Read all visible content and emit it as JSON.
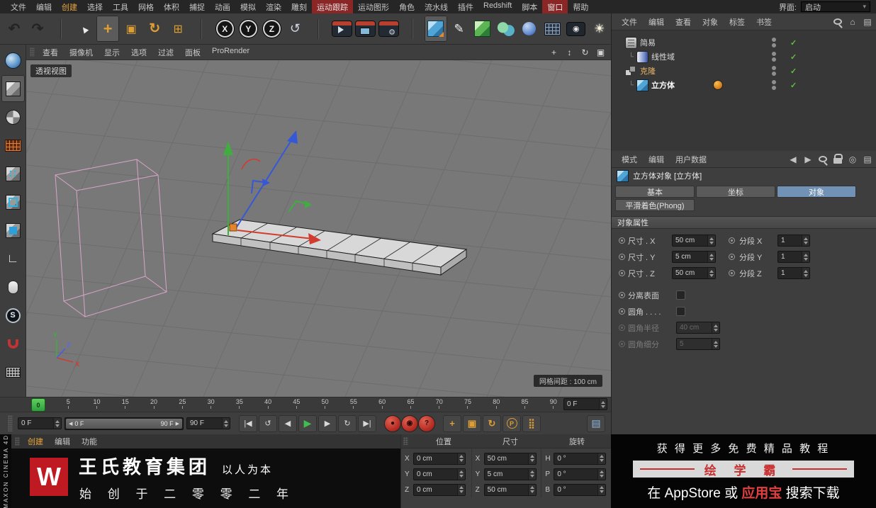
{
  "colors": {
    "accent_orange": "#e8a63c",
    "selected_tab_blue": "#7191b5",
    "play_green": "#3fae4a",
    "record_red": "#c23434",
    "brand_red": "#c83030",
    "enabled_green": "#5fbf3f",
    "axis_green": "#3fae3f",
    "axis_red": "#d23b2d",
    "axis_blue": "#3558d8",
    "viewport_gray": "#787878"
  },
  "menubar": {
    "items": [
      {
        "name": "menubar-item-file",
        "label": "文件"
      },
      {
        "name": "menubar-item-edit",
        "label": "编辑"
      },
      {
        "name": "menubar-item-create",
        "label": "创建",
        "cls": "accent"
      },
      {
        "name": "menubar-item-select",
        "label": "选择"
      },
      {
        "name": "menubar-item-tools",
        "label": "工具"
      },
      {
        "name": "menubar-item-mesh",
        "label": "网格"
      },
      {
        "name": "menubar-item-volume",
        "label": "体积"
      },
      {
        "name": "menubar-item-snap",
        "label": "捕捉"
      },
      {
        "name": "menubar-item-animate",
        "label": "动画"
      },
      {
        "name": "menubar-item-simulate",
        "label": "模拟"
      },
      {
        "name": "menubar-item-render",
        "label": "渲染"
      },
      {
        "name": "menubar-item-sculpt",
        "label": "雕刻"
      },
      {
        "name": "menubar-item-motion-tracker",
        "label": "运动跟踪",
        "cls": "hot"
      },
      {
        "name": "menubar-item-mograph",
        "label": "运动图形"
      },
      {
        "name": "menubar-item-character",
        "label": "角色"
      },
      {
        "name": "menubar-item-pipeline",
        "label": "流水线"
      },
      {
        "name": "menubar-item-plugins",
        "label": "插件"
      },
      {
        "name": "menubar-item-redshift",
        "label": "Redshift"
      },
      {
        "name": "menubar-item-script",
        "label": "脚本"
      },
      {
        "name": "menubar-item-window",
        "label": "窗口",
        "cls": "hot"
      },
      {
        "name": "menubar-item-help",
        "label": "帮助"
      }
    ],
    "interface_label": "界面:",
    "interface_value": "启动"
  },
  "toolbar": {
    "items": [
      {
        "name": "undo-button",
        "icon": "undo-icon",
        "glyph": "↶"
      },
      {
        "name": "redo-button",
        "icon": "redo-icon",
        "glyph": "↷"
      },
      {
        "name": "toolbar-separator",
        "icon": "separator",
        "glyph": "",
        "inter": "false"
      },
      {
        "name": "live-selection-button",
        "icon": "cursor-icon",
        "glyph": "▲"
      },
      {
        "name": "move-tool-button",
        "icon": "move-icon",
        "glyph": "+",
        "cls": "active"
      },
      {
        "name": "scale-tool-button",
        "icon": "scale-icon",
        "glyph": "▣"
      },
      {
        "name": "rotate-tool-button",
        "icon": "rotate-icon",
        "glyph": "↻"
      },
      {
        "name": "last-tool-button",
        "icon": "last-tool-icon",
        "glyph": "⊞"
      },
      {
        "name": "toolbar-separator",
        "icon": "separator",
        "glyph": "",
        "inter": "false"
      },
      {
        "name": "lock-x-axis-button",
        "icon": "axis-lock-icon",
        "glyph": "X"
      },
      {
        "name": "lock-y-axis-button",
        "icon": "axis-lock-icon",
        "glyph": "Y"
      },
      {
        "name": "lock-z-axis-button",
        "icon": "axis-lock-icon",
        "glyph": "Z"
      },
      {
        "name": "coordinate-system-button",
        "icon": "coordinate-system-icon",
        "glyph": "↺"
      },
      {
        "name": "toolbar-separator",
        "icon": "separator",
        "glyph": "",
        "inter": "false"
      },
      {
        "name": "render-view-button",
        "icon": "render-view-icon",
        "glyph": ""
      },
      {
        "name": "render-picture-viewer-button",
        "icon": "render-pv-icon",
        "glyph": ""
      },
      {
        "name": "render-settings-button",
        "icon": "render-settings-icon",
        "glyph": ""
      },
      {
        "name": "toolbar-separator",
        "icon": "separator",
        "glyph": "",
        "inter": "false"
      },
      {
        "name": "primitive-cube-button",
        "icon": "cube-primitive-icon",
        "glyph": "",
        "cls": "active"
      },
      {
        "name": "spline-pen-button",
        "icon": "pen-spline-icon",
        "glyph": "✎"
      },
      {
        "name": "subdivision-surface-button",
        "icon": "subdiv-icon",
        "glyph": ""
      },
      {
        "name": "instance-button",
        "icon": "instance-icon",
        "glyph": ""
      },
      {
        "name": "volume-builder-button",
        "icon": "volume-icon",
        "glyph": ""
      },
      {
        "name": "field-button",
        "icon": "field-grid-icon",
        "glyph": ""
      },
      {
        "name": "camera-button",
        "icon": "camera-icon",
        "glyph": "◉"
      },
      {
        "name": "light-button",
        "icon": "light-icon",
        "glyph": "☀"
      }
    ]
  },
  "left_tools": {
    "items": [
      {
        "name": "make-editable-button",
        "icon": "globe-icon",
        "glyph": ""
      },
      {
        "name": "model-mode-button",
        "icon": "model-mode-icon",
        "glyph": "",
        "cls": "active"
      },
      {
        "name": "texture-mode-button",
        "icon": "texture-mode-icon",
        "glyph": ""
      },
      {
        "name": "workplane-mode-button",
        "icon": "workplane-mode-icon",
        "glyph": ""
      },
      {
        "name": "points-mode-button",
        "icon": "points-mode-icon",
        "glyph": ""
      },
      {
        "name": "edges-mode-button",
        "icon": "edges-mode-icon",
        "glyph": ""
      },
      {
        "name": "polygons-mode-button",
        "icon": "polygons-mode-icon",
        "glyph": ""
      },
      {
        "name": "axis-mode-button",
        "icon": "axis-mode-icon",
        "glyph": "∟"
      },
      {
        "name": "solo-mode-button",
        "icon": "mouse-icon",
        "glyph": ""
      },
      {
        "name": "snap-toggle-button",
        "icon": "snap-icon",
        "glyph": "S"
      },
      {
        "name": "magnet-tool-button",
        "icon": "magnet-icon",
        "glyph": ""
      },
      {
        "name": "workplane-lock-button",
        "icon": "workplane-lock-icon",
        "glyph": ""
      }
    ]
  },
  "viewport": {
    "menu": [
      {
        "name": "viewport-menu-view",
        "label": "查看"
      },
      {
        "name": "viewport-menu-cameras",
        "label": "摄像机"
      },
      {
        "name": "viewport-menu-display",
        "label": "显示"
      },
      {
        "name": "viewport-menu-options",
        "label": "选项"
      },
      {
        "name": "viewport-menu-filter",
        "label": "过滤"
      },
      {
        "name": "viewport-menu-panel",
        "label": "面板"
      },
      {
        "name": "viewport-menu-prorender",
        "label": "ProRender"
      }
    ],
    "nav": [
      {
        "name": "pan-view-icon",
        "glyph": "+"
      },
      {
        "name": "dolly-view-icon",
        "glyph": "↕"
      },
      {
        "name": "rotate-view-icon",
        "glyph": "↻"
      },
      {
        "name": "toggle-view-icon",
        "glyph": "▣"
      }
    ],
    "view_label": "透视视图",
    "grid_spacing": "网格间距 : 100 cm",
    "axis_x": "X",
    "axis_y": "Y",
    "axis_z": "Z"
  },
  "timeline": {
    "ticks": [
      {
        "label": "0"
      },
      {
        "label": "5"
      },
      {
        "label": "10"
      },
      {
        "label": "15"
      },
      {
        "label": "20"
      },
      {
        "label": "25"
      },
      {
        "label": "30"
      },
      {
        "label": "35"
      },
      {
        "label": "40"
      },
      {
        "label": "45"
      },
      {
        "label": "50"
      },
      {
        "label": "55"
      },
      {
        "label": "60"
      },
      {
        "label": "65"
      },
      {
        "label": "70"
      },
      {
        "label": "75"
      },
      {
        "label": "80"
      },
      {
        "label": "85"
      },
      {
        "label": "90"
      }
    ],
    "playhead": "0",
    "current": "0 F"
  },
  "transport": {
    "current": "0 F",
    "range_start": "0 F",
    "range_end": "90 F",
    "end": "90 F",
    "arrow_left": "◀",
    "arrow_right": "▶",
    "buttons": [
      {
        "name": "goto-start-button",
        "glyph": "|◀"
      },
      {
        "name": "play-backwards-button",
        "glyph": "↺"
      },
      {
        "name": "previous-frame-button",
        "glyph": "◀"
      },
      {
        "name": "play-forwards-button",
        "glyph": "▶",
        "cls": "play"
      },
      {
        "name": "next-frame-button",
        "glyph": "▶"
      },
      {
        "name": "loop-button",
        "glyph": "↻"
      },
      {
        "name": "goto-end-button",
        "glyph": "▶|"
      }
    ],
    "record_buttons": [
      {
        "name": "record-keyframe-button",
        "glyph": "●"
      },
      {
        "name": "autokey-button",
        "glyph": "◉"
      },
      {
        "name": "keyframe-selection-button",
        "glyph": "?"
      }
    ],
    "key_toggles": [
      {
        "name": "record-position-button",
        "glyph": "+"
      },
      {
        "name": "record-scale-button",
        "glyph": "▣"
      },
      {
        "name": "record-rotation-button",
        "glyph": "↻"
      },
      {
        "name": "record-parameter-button",
        "glyph": "P",
        "gcls": "pcirc"
      },
      {
        "name": "point-level-animation-button",
        "glyph": "⣿"
      }
    ],
    "window_button": {
      "name": "timeline-window-button",
      "glyph": "▤"
    }
  },
  "materials": {
    "menu": [
      {
        "name": "material-menu-create",
        "label": "创建",
        "cls": "accent"
      },
      {
        "name": "material-menu-edit",
        "label": "编辑"
      },
      {
        "name": "material-menu-function",
        "label": "功能"
      }
    ]
  },
  "branding": {
    "vertical": "MAXON CINEMA 4D",
    "logo": "W",
    "company": "王氏教育集团",
    "slogan": "以人为本",
    "since": "始 创 于 二 零 零 二 年"
  },
  "coords": {
    "headers": [
      {
        "name": "coords-header-position",
        "label": "位置"
      },
      {
        "name": "coords-header-size",
        "label": "尺寸"
      },
      {
        "name": "coords-header-rotation",
        "label": "旋转"
      }
    ],
    "position": [
      {
        "name": "position-x-field",
        "axis": "X",
        "value": "0 cm"
      },
      {
        "name": "position-y-field",
        "axis": "Y",
        "value": "0 cm"
      },
      {
        "name": "position-z-field",
        "axis": "Z",
        "value": "0 cm"
      }
    ],
    "size": [
      {
        "name": "size-x-coord-field",
        "axis": "X",
        "value": "50 cm"
      },
      {
        "name": "size-y-coord-field",
        "axis": "Y",
        "value": "5 cm"
      },
      {
        "name": "size-z-coord-field",
        "axis": "Z",
        "value": "50 cm"
      }
    ],
    "rotation": [
      {
        "name": "rotation-h-field",
        "axis": "H",
        "value": "0 °"
      },
      {
        "name": "rotation-p-field",
        "axis": "P",
        "value": "0 °"
      },
      {
        "name": "rotation-b-field",
        "axis": "B",
        "value": "0 °"
      }
    ]
  },
  "ad": {
    "line1": "获 得 更 多 免 费 精 品 教 程",
    "brand": "绘 学 霸",
    "line3_pre": "在 ",
    "line3_appstore": "AppStore",
    "line3_mid": " 或 ",
    "line3_store": "应用宝",
    "line3_post": " 搜索下载"
  },
  "object_manager": {
    "menu": [
      {
        "name": "om-menu-file",
        "label": "文件"
      },
      {
        "name": "om-menu-edit",
        "label": "编辑"
      },
      {
        "name": "om-menu-view",
        "label": "查看"
      },
      {
        "name": "om-menu-objects",
        "label": "对象"
      },
      {
        "name": "om-menu-tags",
        "label": "标签"
      },
      {
        "name": "om-menu-bookmarks",
        "label": "书签"
      }
    ],
    "icons": [
      {
        "name": "search-icon",
        "cls": "mag-icon",
        "glyph": ""
      },
      {
        "name": "home-icon",
        "glyph": "⌂"
      },
      {
        "name": "panel-menu-icon",
        "glyph": "▤"
      }
    ],
    "objects": [
      {
        "name": "object-row-plain",
        "label": "简易",
        "icon": "plain-effector-icon",
        "check": "✓"
      },
      {
        "name": "object-row-linear-field",
        "label": "线性域",
        "icon": "linear-field-icon",
        "branch": "└",
        "rowcls": "child",
        "check": "✓"
      },
      {
        "name": "object-row-cloner",
        "label": "克隆",
        "icon": "cloner-icon",
        "lcls": "accent",
        "check": "✓"
      },
      {
        "name": "object-row-cube",
        "label": "立方体",
        "icon": "cube-object-icon",
        "branch": "└",
        "rowcls": "child",
        "lcls": "selected",
        "check": "✓",
        "tag": "material-tag"
      }
    ]
  },
  "attributes": {
    "menu": [
      {
        "name": "am-menu-mode",
        "label": "模式"
      },
      {
        "name": "am-menu-edit",
        "label": "编辑"
      },
      {
        "name": "am-menu-userdata",
        "label": "用户数据"
      }
    ],
    "icons": [
      {
        "name": "nav-back-icon",
        "glyph": "◀"
      },
      {
        "name": "nav-forward-icon",
        "glyph": "▶"
      },
      {
        "name": "search-icon",
        "cls": "mag-icon",
        "glyph": ""
      },
      {
        "name": "lock-icon",
        "cls": "lock-glyph",
        "glyph": ""
      },
      {
        "name": "focus-icon",
        "glyph": "◎"
      },
      {
        "name": "panel-menu-icon",
        "glyph": "▤"
      }
    ],
    "title": "立方体对象 [立方体]",
    "tabs": [
      {
        "name": "tab-basic",
        "label": "基本"
      },
      {
        "name": "tab-coordinates",
        "label": "坐标"
      },
      {
        "name": "tab-object",
        "label": "对象",
        "cls": "selected"
      },
      {
        "name": "tab-phong",
        "label": "平滑着色(Phong)"
      }
    ],
    "section": "对象属性",
    "rows": [
      {
        "label": "尺寸 . X",
        "value": "50 cm",
        "fname": "size-x-field",
        "label2": "分段 X",
        "value2": "1",
        "fname2": "segments-x-field"
      },
      {
        "label": "尺寸 . Y",
        "value": "5 cm",
        "fname": "size-y-field",
        "label2": "分段 Y",
        "value2": "1",
        "fname2": "segments-y-field"
      },
      {
        "label": "尺寸 . Z",
        "value": "50 cm",
        "fname": "size-z-field",
        "label2": "分段 Z",
        "value2": "1",
        "fname2": "segments-z-field"
      }
    ],
    "checks": [
      {
        "name": "separate-surfaces-checkbox",
        "label": "分离表面"
      },
      {
        "name": "fillet-checkbox",
        "label": "圆角 . . . ."
      }
    ],
    "disabled": [
      {
        "name": "fillet-radius-field",
        "label": "圆角半径",
        "value": "40 cm"
      },
      {
        "name": "fillet-subdivision-field",
        "label": "圆角细分",
        "value": "5"
      }
    ]
  }
}
